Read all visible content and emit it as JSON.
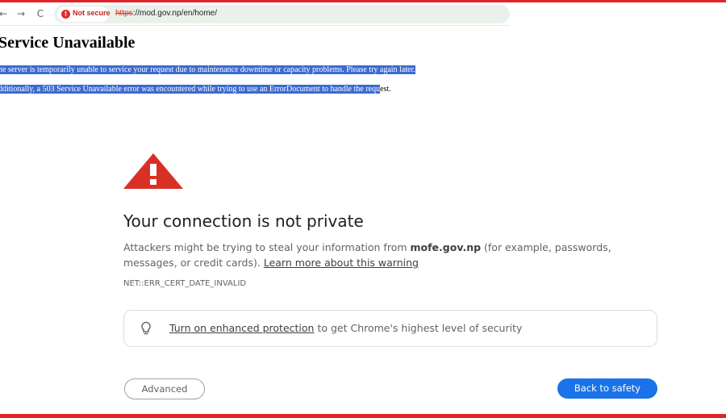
{
  "browser": {
    "back_icon": "←",
    "forward_icon": "→",
    "reload_icon": "C",
    "security_chip": "Not secure",
    "url_scheme": "https",
    "url_rest": "://mod.gov.np/en/home/"
  },
  "apache": {
    "title": "Service Unavailable",
    "paragraph1": "he server is temporarily unable to service your request due to maintenance downtime or capacity problems. Please try again later.",
    "paragraph2_selected": "dditionally, a 503 Service Unavailable error was encountered while trying to use an ErrorDocument to handle the requ",
    "paragraph2_rest": "est."
  },
  "interstitial": {
    "heading": "Your connection is not private",
    "body_prefix": "Attackers might be trying to steal your information from ",
    "domain": "mofe.gov.np",
    "body_suffix": " (for example, passwords, messages, or credit cards). ",
    "learn_more": "Learn more about this warning",
    "error_code": "NET::ERR_CERT_DATE_INVALID",
    "protection_link": "Turn on enhanced protection",
    "protection_text": " to get Chrome's highest level of security",
    "advanced_label": "Advanced",
    "back_label": "Back to safety"
  },
  "colors": {
    "frame": "#e0242a",
    "selection": "#3b6bd0",
    "warning": "#d93025",
    "primary_button": "#1a73e8"
  }
}
